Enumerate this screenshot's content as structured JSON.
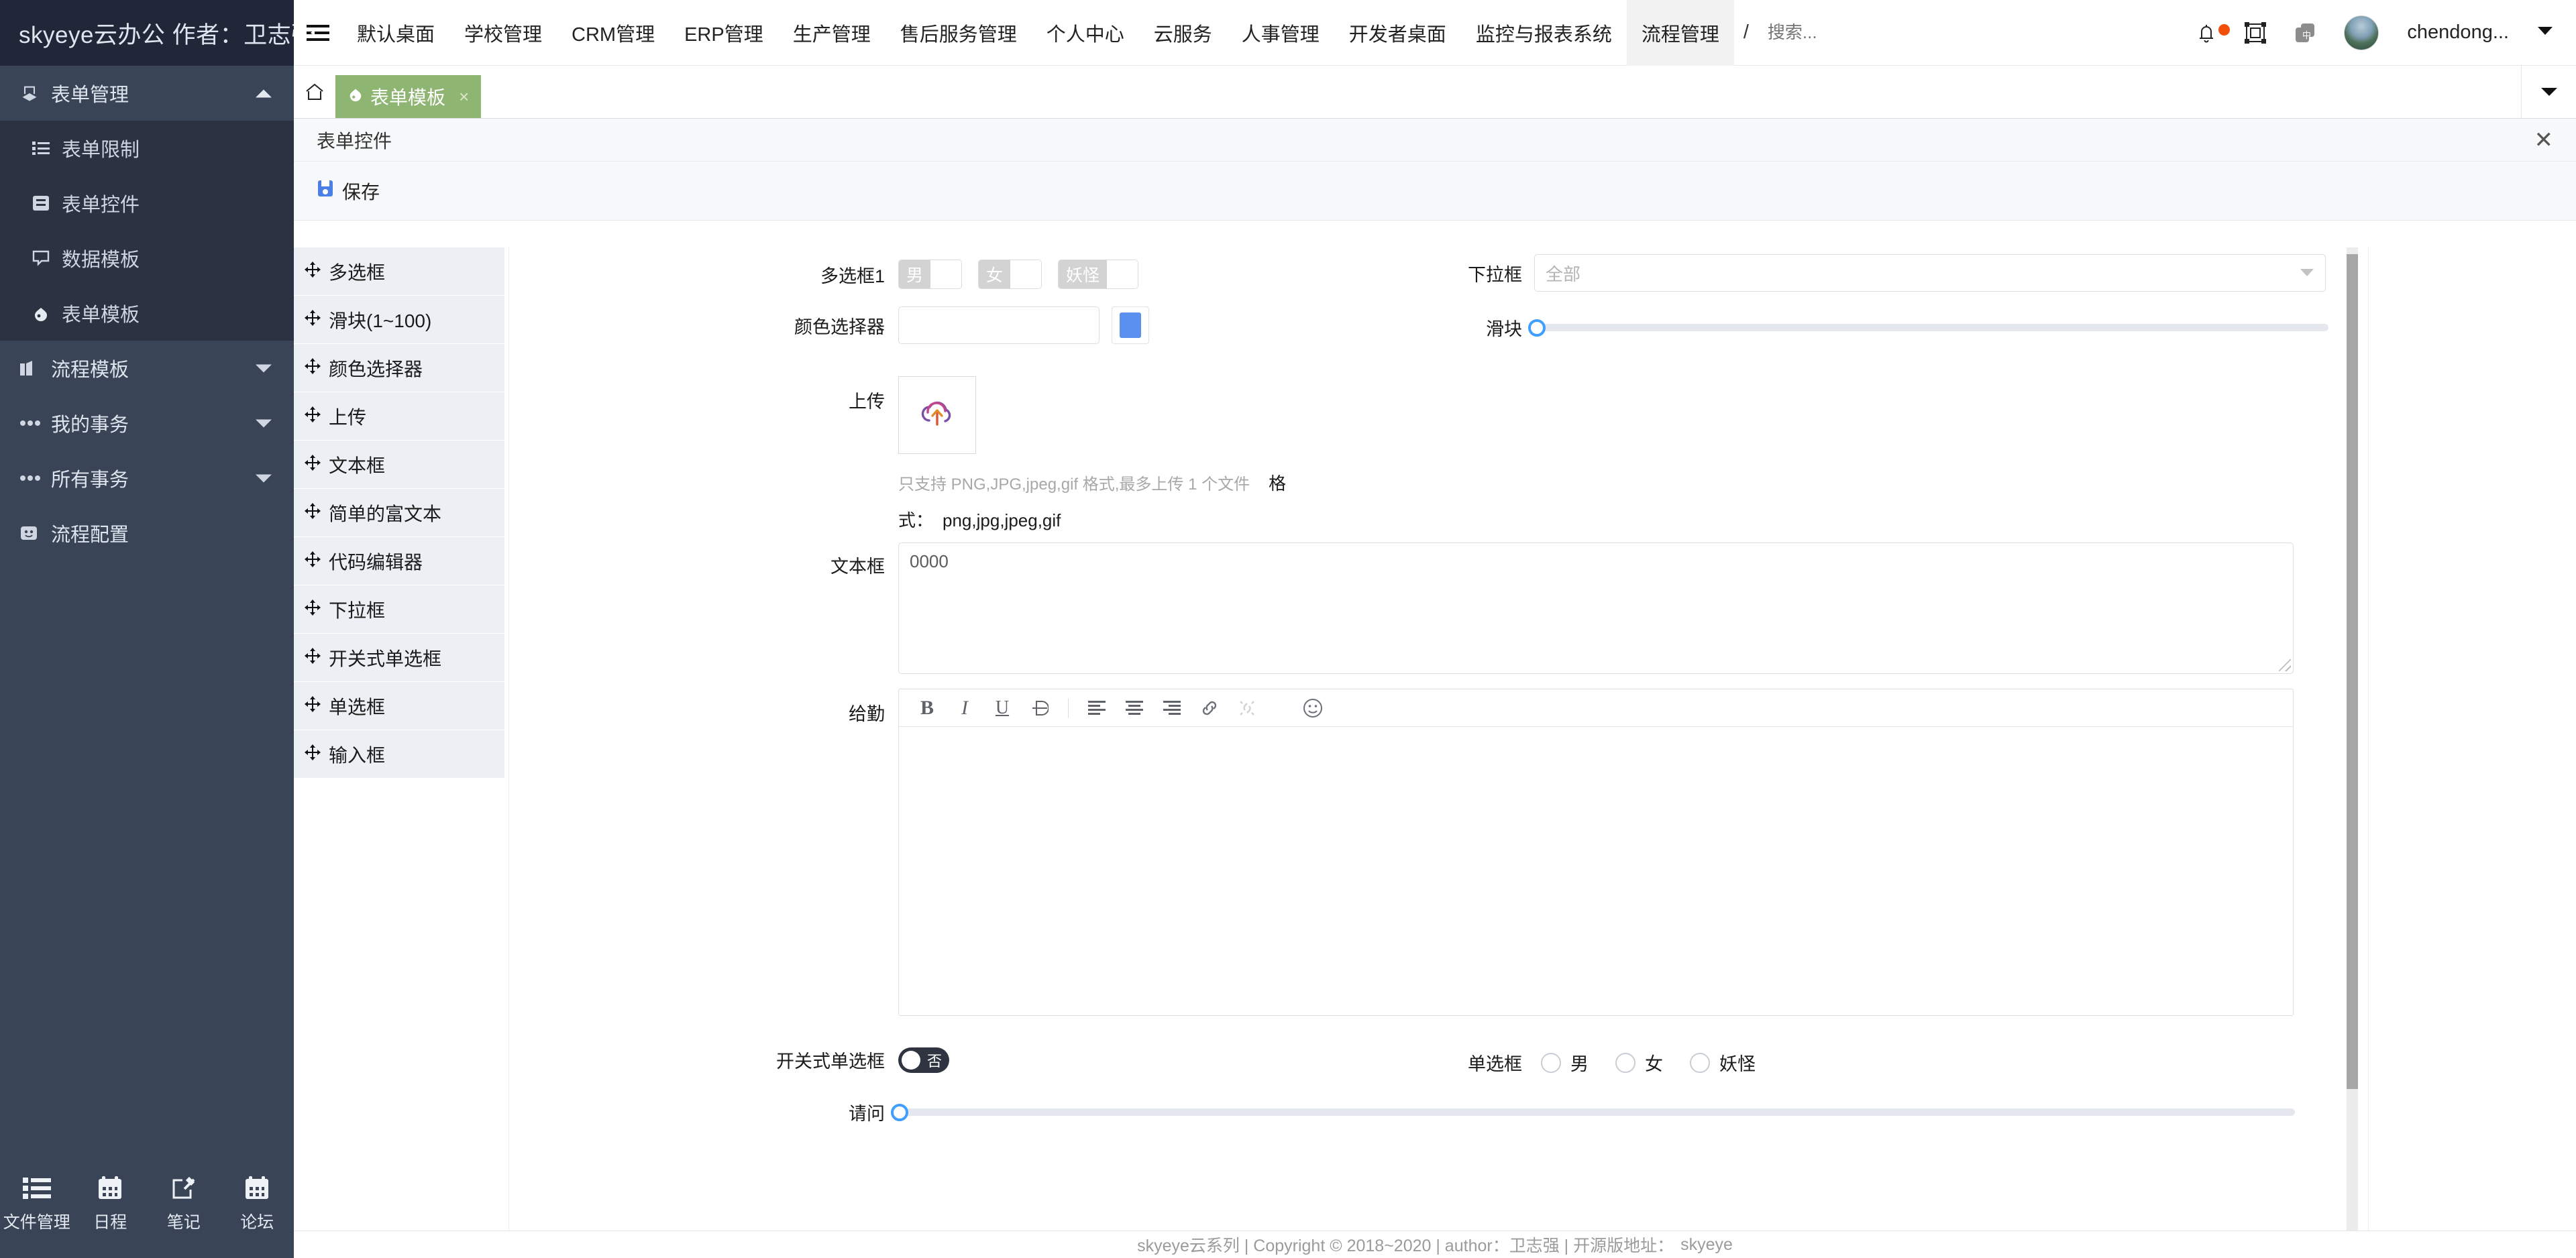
{
  "brand": {
    "title": "skyeye云办公 作者：卫志强"
  },
  "sidebar": {
    "group": {
      "label": "表单管理",
      "icon": "forms-icon",
      "caret": "caret-up-icon"
    },
    "sub_items": [
      {
        "label": "表单限制",
        "icon": "list-icon"
      },
      {
        "label": "表单控件",
        "icon": "book-icon"
      },
      {
        "label": "数据模板",
        "icon": "chat-icon"
      },
      {
        "label": "表单模板",
        "icon": "drop-icon"
      }
    ],
    "groups": [
      {
        "label": "流程模板",
        "icon": "flow-icon",
        "caret": "caret-down-icon"
      },
      {
        "label": "我的事务",
        "icon": "dots-icon",
        "caret": "caret-down-icon"
      },
      {
        "label": "所有事务",
        "icon": "dots-icon",
        "caret": "caret-down-icon"
      },
      {
        "label": "流程配置",
        "icon": "config-icon",
        "caret": ""
      }
    ],
    "dock": [
      {
        "label": "文件管理",
        "icon": "list-icon"
      },
      {
        "label": "日程",
        "icon": "calendar-icon"
      },
      {
        "label": "笔记",
        "icon": "pencil-square-icon"
      },
      {
        "label": "论坛",
        "icon": "calendar-icon"
      }
    ]
  },
  "topbar": {
    "hamburger": "menu-fold-icon",
    "nav": [
      "默认桌面",
      "学校管理",
      "CRM管理",
      "ERP管理",
      "生产管理",
      "售后服务管理",
      "个人中心",
      "云服务",
      "人事管理",
      "开发者桌面",
      "监控与报表系统",
      "流程管理"
    ],
    "active_nav": "流程管理",
    "nav_more": "/",
    "search_placeholder": "搜索...",
    "bell_icon": "bell-icon",
    "fullscreen_icon": "fullscreen-icon",
    "lang_icon": "language-icon",
    "lang_glyph": "中",
    "username": "chendong..."
  },
  "tabstrip": {
    "home_icon": "home-icon",
    "tabs": [
      {
        "label": "表单模板",
        "icon": "drop-icon",
        "close": "×"
      }
    ],
    "caret": "caret-down-icon"
  },
  "panel": {
    "title": "表单控件",
    "close": "✕"
  },
  "toolbar": {
    "save_label": "保存",
    "save_icon": "save-icon"
  },
  "palette": {
    "items": [
      "多选框",
      "滑块(1~100)",
      "颜色选择器",
      "上传",
      "文本框",
      "简单的富文本",
      "代码编辑器",
      "下拉框",
      "开关式单选框",
      "单选框",
      "输入框"
    ],
    "drag_icon": "drag-move-icon"
  },
  "form": {
    "multicheck": {
      "label": "多选框1",
      "options": [
        "男",
        "女",
        "妖怪"
      ]
    },
    "select": {
      "label": "下拉框",
      "value": "全部",
      "arrow": "caret-down-icon"
    },
    "colorpicker": {
      "label": "颜色选择器",
      "value": "",
      "swatch": "#5b8ff0"
    },
    "slider_top": {
      "label": "滑块",
      "value": 0
    },
    "upload": {
      "label": "上传",
      "icon": "cloud-upload-icon",
      "hint": "只支持 PNG,JPG,jpeg,gif 格式,最多上传 1 个文件",
      "hint_extra": "格",
      "format_label": "式：",
      "format_value": "png,jpg,jpeg,gif"
    },
    "textarea": {
      "label": "文本框",
      "value": "0000"
    },
    "richtext": {
      "label": "给勤",
      "value": "",
      "toolbar": [
        {
          "name": "bold-icon",
          "glyph": "B"
        },
        {
          "name": "italic-icon",
          "glyph": "I"
        },
        {
          "name": "underline-icon",
          "glyph": "U"
        },
        {
          "name": "strikethrough-icon",
          "glyph": "D"
        },
        {
          "name": "align-left-icon",
          "glyph": ""
        },
        {
          "name": "align-center-icon",
          "glyph": ""
        },
        {
          "name": "align-right-icon",
          "glyph": ""
        },
        {
          "name": "link-icon",
          "glyph": ""
        },
        {
          "name": "unlink-icon",
          "glyph": ""
        },
        {
          "name": "emoji-icon",
          "glyph": ""
        }
      ]
    },
    "switch_radio": {
      "label": "开关式单选框",
      "state_text": "否"
    },
    "radio": {
      "label": "单选框",
      "options": [
        "男",
        "女",
        "妖怪"
      ]
    },
    "slider_bottom": {
      "label": "请问",
      "value": 0
    }
  },
  "footer": {
    "text": "skyeye云系列 | Copyright © 2018~2020 | author：卫志强 | 开源版地址：",
    "link": "skyeye"
  }
}
